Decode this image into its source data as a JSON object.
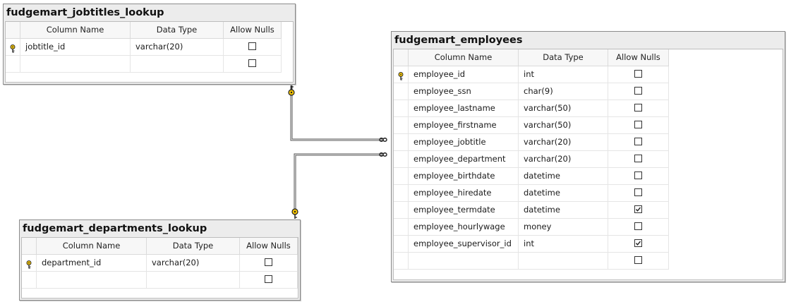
{
  "columns_header": {
    "name": "Column Name",
    "type": "Data Type",
    "nulls": "Allow Nulls"
  },
  "tables": {
    "jobtitles": {
      "title": "fudgemart_jobtitles_lookup",
      "rows": [
        {
          "name": "jobtitle_id",
          "type": "varchar(20)",
          "allow_nulls": false,
          "primary_key": true
        }
      ]
    },
    "departments": {
      "title": "fudgemart_departments_lookup",
      "rows": [
        {
          "name": "department_id",
          "type": "varchar(20)",
          "allow_nulls": false,
          "primary_key": true
        }
      ]
    },
    "employees": {
      "title": "fudgemart_employees",
      "rows": [
        {
          "name": "employee_id",
          "type": "int",
          "allow_nulls": false,
          "primary_key": true
        },
        {
          "name": "employee_ssn",
          "type": "char(9)",
          "allow_nulls": false,
          "primary_key": false
        },
        {
          "name": "employee_lastname",
          "type": "varchar(50)",
          "allow_nulls": false,
          "primary_key": false
        },
        {
          "name": "employee_firstname",
          "type": "varchar(50)",
          "allow_nulls": false,
          "primary_key": false
        },
        {
          "name": "employee_jobtitle",
          "type": "varchar(20)",
          "allow_nulls": false,
          "primary_key": false
        },
        {
          "name": "employee_department",
          "type": "varchar(20)",
          "allow_nulls": false,
          "primary_key": false
        },
        {
          "name": "employee_birthdate",
          "type": "datetime",
          "allow_nulls": false,
          "primary_key": false
        },
        {
          "name": "employee_hiredate",
          "type": "datetime",
          "allow_nulls": false,
          "primary_key": false
        },
        {
          "name": "employee_termdate",
          "type": "datetime",
          "allow_nulls": true,
          "primary_key": false
        },
        {
          "name": "employee_hourlywage",
          "type": "money",
          "allow_nulls": false,
          "primary_key": false
        },
        {
          "name": "employee_supervisor_id",
          "type": "int",
          "allow_nulls": true,
          "primary_key": false
        }
      ]
    }
  },
  "relationships": [
    {
      "from": "jobtitles",
      "to": "employees",
      "one_end_icon": "key-icon",
      "many_end_icon": "infinity-icon"
    },
    {
      "from": "departments",
      "to": "employees",
      "one_end_icon": "key-icon",
      "many_end_icon": "infinity-icon"
    }
  ],
  "icons": {
    "primary_key": "key-icon",
    "checkbox": "checkbox-icon"
  },
  "colors": {
    "key": "#f2c200",
    "title_bar": "#ececec",
    "border": "#8c8c8c"
  }
}
